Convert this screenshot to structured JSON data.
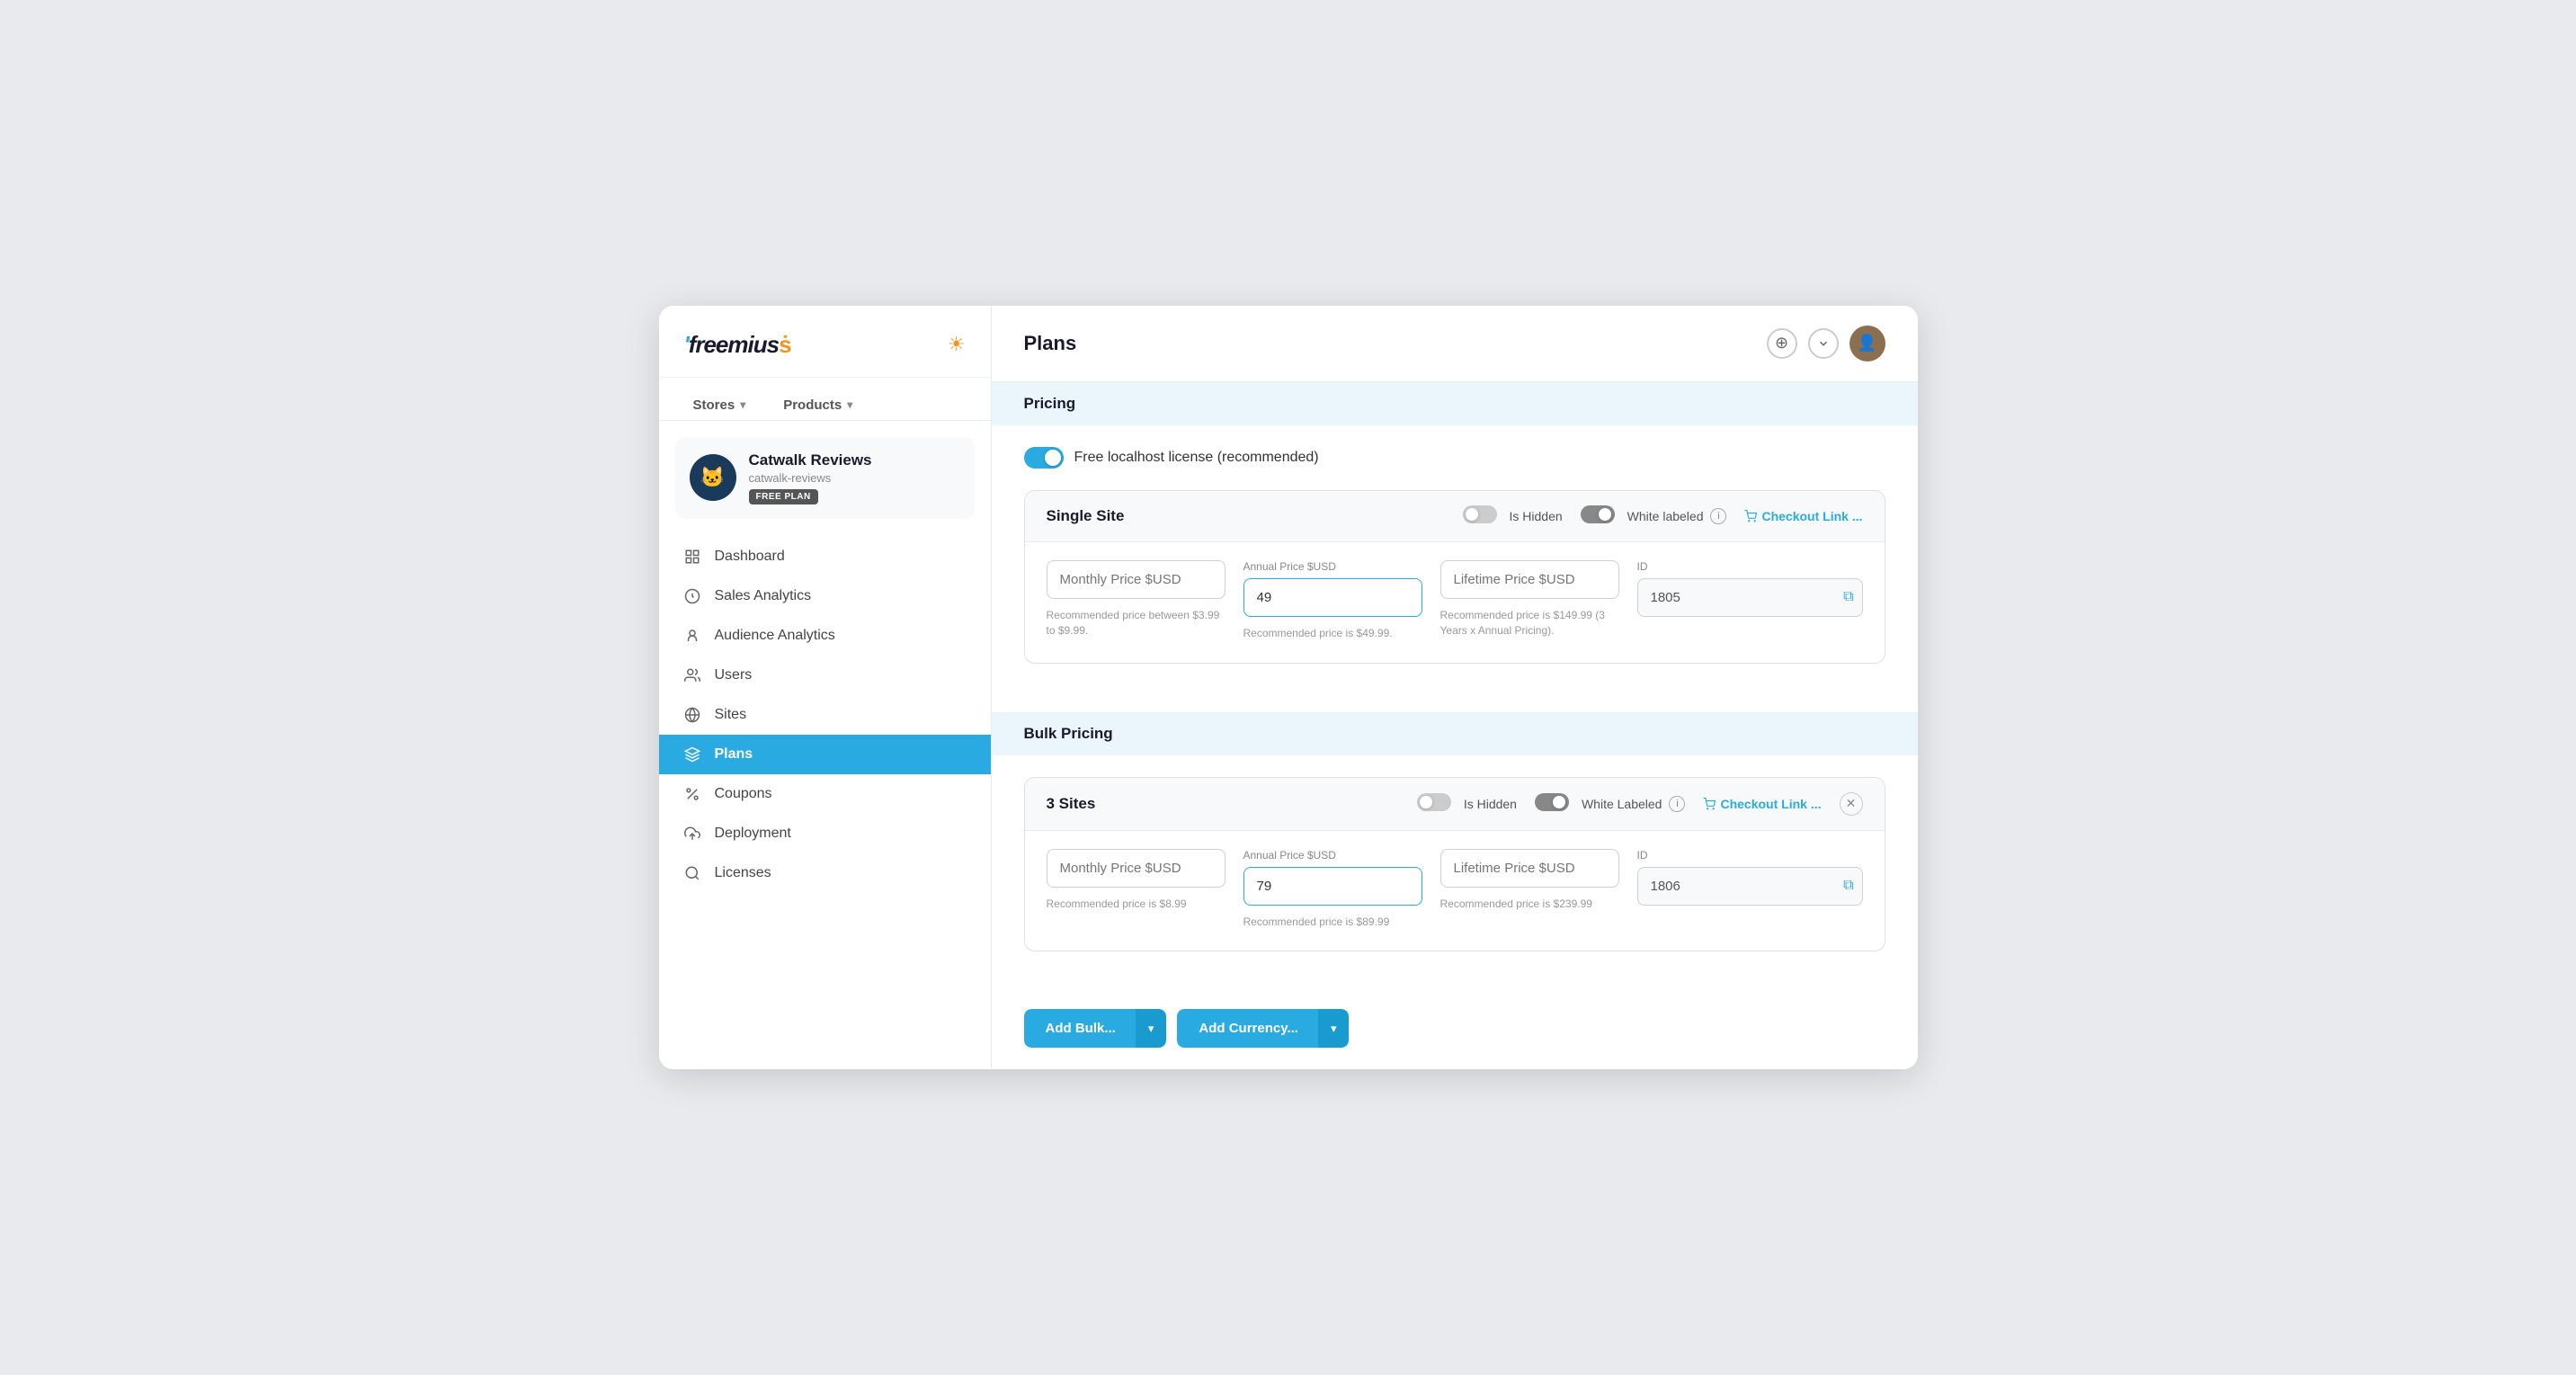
{
  "app": {
    "logo": "freemius",
    "logo_dot": "ṡ"
  },
  "header": {
    "title": "Plans"
  },
  "nav_tabs": [
    {
      "id": "stores",
      "label": "Stores",
      "has_chevron": true
    },
    {
      "id": "products",
      "label": "Products",
      "has_chevron": true
    }
  ],
  "product": {
    "name": "Catwalk Reviews",
    "slug": "catwalk-reviews",
    "plan": "FREE PLAN",
    "emoji": "🐱"
  },
  "sidebar_nav": [
    {
      "id": "dashboard",
      "label": "Dashboard",
      "icon": "grid"
    },
    {
      "id": "sales-analytics",
      "label": "Sales Analytics",
      "icon": "chart-line"
    },
    {
      "id": "audience-analytics",
      "label": "Audience Analytics",
      "icon": "user-circle"
    },
    {
      "id": "users",
      "label": "Users",
      "icon": "users"
    },
    {
      "id": "sites",
      "label": "Sites",
      "icon": "globe"
    },
    {
      "id": "plans",
      "label": "Plans",
      "icon": "layers",
      "active": true
    },
    {
      "id": "coupons",
      "label": "Coupons",
      "icon": "percent"
    },
    {
      "id": "deployment",
      "label": "Deployment",
      "icon": "upload"
    },
    {
      "id": "licenses",
      "label": "Licenses",
      "icon": "search"
    }
  ],
  "content": {
    "pricing_section_label": "Pricing",
    "free_localhost_label": "Free localhost license (recommended)",
    "free_localhost_enabled": true,
    "single_site": {
      "title": "Single Site",
      "is_hidden": false,
      "white_labeled": true,
      "white_labeled_label": "White labeled",
      "is_hidden_label": "Is Hidden",
      "checkout_link_label": "Checkout Link ...",
      "monthly_price_placeholder": "Monthly Price $USD",
      "annual_price_label": "Annual Price $USD",
      "annual_price_value": "49",
      "lifetime_price_placeholder": "Lifetime Price $USD",
      "id_label": "ID",
      "id_value": "1805",
      "monthly_hint": "Recommended price between $3.99 to $9.99.",
      "annual_hint": "Recommended price is $49.99.",
      "lifetime_hint": "Recommended price is $149.99 (3 Years x Annual Pricing)."
    },
    "bulk_pricing_section_label": "Bulk Pricing",
    "bulk_site": {
      "title": "3 Sites",
      "is_hidden": false,
      "white_labeled": true,
      "white_labeled_label": "White Labeled",
      "is_hidden_label": "Is Hidden",
      "checkout_link_label": "Checkout Link ...",
      "monthly_price_placeholder": "Monthly Price $USD",
      "annual_price_label": "Annual Price $USD",
      "annual_price_value": "79",
      "lifetime_price_placeholder": "Lifetime Price $USD",
      "id_label": "ID",
      "id_value": "1806",
      "monthly_hint": "Recommended price is $8.99",
      "annual_hint": "Recommended price is $89.99",
      "lifetime_hint": "Recommended price is $239.99"
    },
    "buttons": {
      "add_bulk_label": "Add Bulk...",
      "add_currency_label": "Add Currency..."
    }
  }
}
